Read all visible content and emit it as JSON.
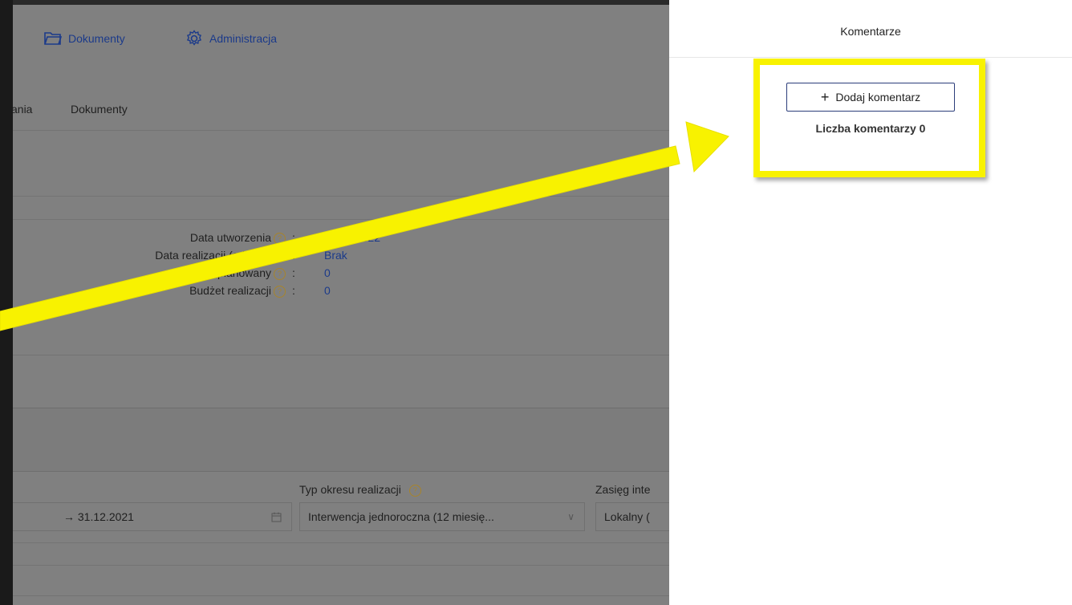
{
  "nav": {
    "documents": "Dokumenty",
    "admin": "Administracja"
  },
  "tabs": {
    "partial": "ania",
    "documents": "Dokumenty"
  },
  "details": {
    "created_label": "Data utworzenia",
    "created_value": "20.05.2022",
    "realization_label": "Data realizacji (od - do)",
    "realization_value": "Brak",
    "budget_planned_label": "Budżet planowany",
    "budget_planned_value": "0",
    "budget_real_label": "Budżet realizacji",
    "budget_real_value": "0",
    "colon": ":"
  },
  "form": {
    "date_range_end": "→ 31.12.2021",
    "period_type_label": "Typ okresu realizacji",
    "period_type_value": "Interwencja jednoroczna (12 miesię...",
    "scope_label": "Zasięg inte",
    "scope_value": "Lokalny (",
    "help_icon": "?"
  },
  "comments": {
    "title": "Komentarze",
    "add_button": "Dodaj komentarz",
    "count_label": "Liczba komentarzy 0"
  },
  "colors": {
    "highlight": "#f8f200",
    "link": "#1b3a8a",
    "overlay": "#808080"
  }
}
